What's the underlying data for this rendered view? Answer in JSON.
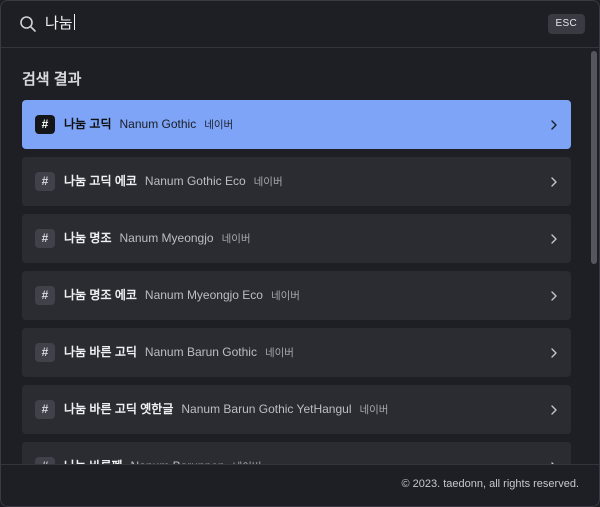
{
  "search": {
    "query": "나눔",
    "esc_label": "ESC"
  },
  "results": {
    "section_title": "검색 결과",
    "items": [
      {
        "hash": "#",
        "name_ko": "나눔 고딕",
        "name_en": "Nanum Gothic",
        "vendor": "네이버",
        "active": true
      },
      {
        "hash": "#",
        "name_ko": "나눔 고딕 에코",
        "name_en": "Nanum Gothic Eco",
        "vendor": "네이버",
        "active": false
      },
      {
        "hash": "#",
        "name_ko": "나눔 명조",
        "name_en": "Nanum Myeongjo",
        "vendor": "네이버",
        "active": false
      },
      {
        "hash": "#",
        "name_ko": "나눔 명조 에코",
        "name_en": "Nanum Myeongjo Eco",
        "vendor": "네이버",
        "active": false
      },
      {
        "hash": "#",
        "name_ko": "나눔 바른 고딕",
        "name_en": "Nanum Barun Gothic",
        "vendor": "네이버",
        "active": false
      },
      {
        "hash": "#",
        "name_ko": "나눔 바른 고딕 옛한글",
        "name_en": "Nanum Barun Gothic YetHangul",
        "vendor": "네이버",
        "active": false
      },
      {
        "hash": "#",
        "name_ko": "나눔 바른펜",
        "name_en": "Nanum Barunpen",
        "vendor": "네이버",
        "active": false
      }
    ]
  },
  "footer": {
    "copyright": "© 2023. taedonn, all rights reserved."
  },
  "colors": {
    "background": "#1e1f24",
    "item_background": "#2b2c32",
    "active_item": "#7ea4f7"
  }
}
